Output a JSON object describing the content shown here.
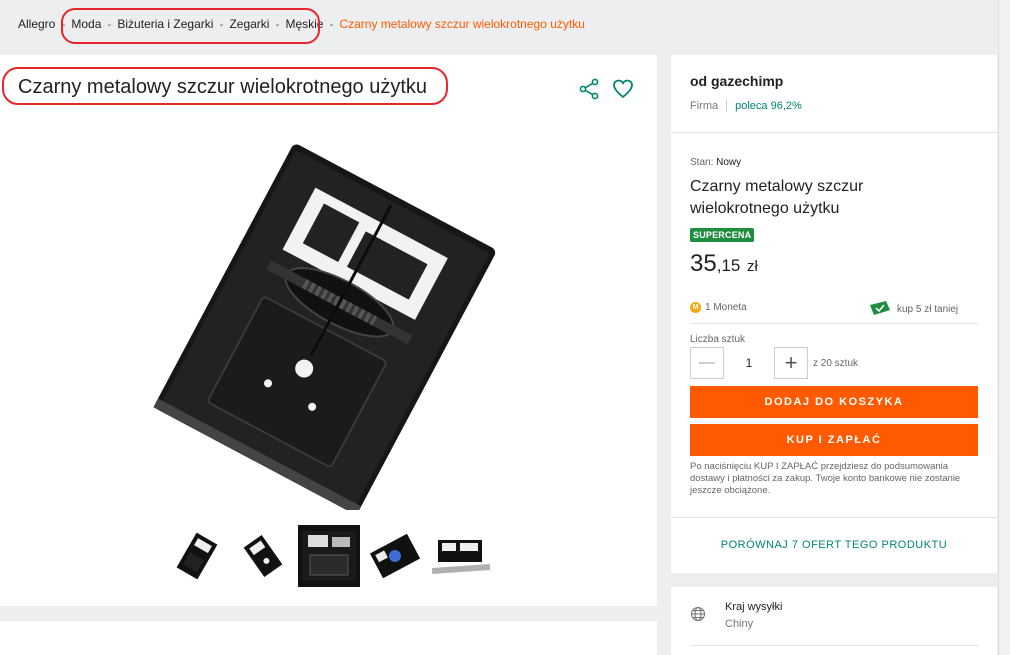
{
  "breadcrumb": {
    "items": [
      "Allegro",
      "Moda",
      "Biżuteria i Zegarki",
      "Zegarki",
      "Męskie"
    ],
    "current": "Czarny metalowy szczur wielokrotnego użytku",
    "separator": "-"
  },
  "product": {
    "title": "Czarny metalowy szczur wielokrotnego użytku"
  },
  "icons": {
    "share": "share-icon",
    "favorite": "heart-icon",
    "globe": "globe-icon",
    "coin": "moneta-icon",
    "ticket": "ticket-icon"
  },
  "seller": {
    "name": "od gazechimp",
    "type": "Firma",
    "recommend": "poleca 96,2%"
  },
  "offer": {
    "condition_label": "Stan:",
    "condition_value": "Nowy",
    "title": "Czarny metalowy szczur wielokrotnego użytku",
    "badge": "SUPERCENA",
    "price_main": "35",
    "price_cents": ",15",
    "currency": "zł",
    "coins": "1 Moneta",
    "coin_letter": "M",
    "discount": "kup 5 zł taniej",
    "qty_label": "Liczba sztuk",
    "qty_value": "1",
    "qty_minus": "—",
    "qty_plus": "+",
    "qty_available": "z 20 sztuk",
    "add_to_cart": "DODAJ DO KOSZYKA",
    "buy_now": "KUP I ZAPŁAĆ",
    "note": "Po naciśnięciu KUP I ZAPŁAĆ przejdziesz do podsumowania dostawy i płatności za zakup. Twoje konto bankowe nie zostanie jeszcze obciążone.",
    "compare": "PORÓWNAJ 7 OFERT TEGO PRODUKTU"
  },
  "shipping": {
    "label": "Kraj wysyłki",
    "value": "Chiny"
  },
  "colors": {
    "accent": "#ff5a00",
    "teal": "#008673",
    "badge_green": "#1e8e3e",
    "annotation_red": "#e8252b"
  }
}
